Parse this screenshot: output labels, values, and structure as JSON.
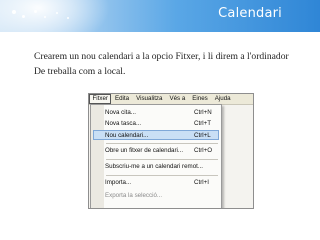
{
  "banner": {
    "title": "Calendari"
  },
  "body": {
    "line1": "Crearem un nou calendari a la opcio Fitxer, i li direm a l'ordinador",
    "line2": "De treballa com a local."
  },
  "screenshot": {
    "menubar": [
      "Fitxer",
      "Edita",
      "Visualitza",
      "Vés a",
      "Eines",
      "Ajuda"
    ],
    "menu_items": [
      {
        "label": "Nova cita...",
        "shortcut": "Ctrl+N"
      },
      {
        "label": "Nova tasca...",
        "shortcut": "Ctrl+T"
      },
      {
        "label": "Nou calendari...",
        "shortcut": "Ctrl+L"
      },
      {
        "label": "Obre un fitxer de calendari...",
        "shortcut": "Ctrl+O"
      },
      {
        "label": "Subscriu-me a un calendari remot...",
        "shortcut": ""
      },
      {
        "label": "Importa...",
        "shortcut": "Ctrl+I"
      },
      {
        "label": "Exporta la selecció...",
        "shortcut": ""
      }
    ]
  }
}
